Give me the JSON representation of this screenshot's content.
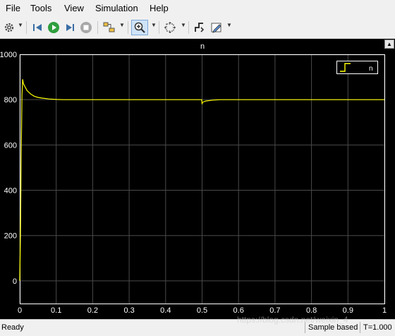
{
  "menu": [
    "File",
    "Tools",
    "View",
    "Simulation",
    "Help"
  ],
  "plot": {
    "title": "n",
    "legend_label": "n",
    "line_color": "#ffff00",
    "background": "#000000",
    "axis_color": "#ffffff",
    "grid_color": "#555555"
  },
  "chart_data": {
    "type": "line",
    "title": "n",
    "xlim": [
      0,
      1
    ],
    "ylim": [
      -100,
      1000
    ],
    "xticks": [
      "0",
      "0.1",
      "0.2",
      "0.3",
      "0.4",
      "0.5",
      "0.6",
      "0.7",
      "0.8",
      "0.9",
      "1"
    ],
    "yticks": [
      "0",
      "200",
      "400",
      "600",
      "800",
      "1000"
    ],
    "grid": true,
    "legend_position": "top-right",
    "series": [
      {
        "name": "n",
        "x": [
          0,
          0.002,
          0.004,
          0.006,
          0.008,
          0.01,
          0.015,
          0.02,
          0.03,
          0.04,
          0.05,
          0.06,
          0.08,
          0.1,
          0.12,
          0.14,
          0.2,
          0.3,
          0.4,
          0.499,
          0.5,
          0.501,
          0.51,
          0.53,
          0.55,
          0.6,
          0.8,
          1.0
        ],
        "y": [
          0,
          200,
          560,
          820,
          890,
          870,
          855,
          840,
          825,
          815,
          810,
          807,
          803,
          801,
          800,
          800,
          800,
          800,
          800,
          800,
          780,
          788,
          794,
          798,
          800,
          800,
          800,
          800
        ]
      }
    ]
  },
  "status": {
    "ready": "Ready",
    "mode": "Sample based",
    "time": "T=1.000"
  },
  "watermark": "https://blog.csdn.net/weixin_4"
}
